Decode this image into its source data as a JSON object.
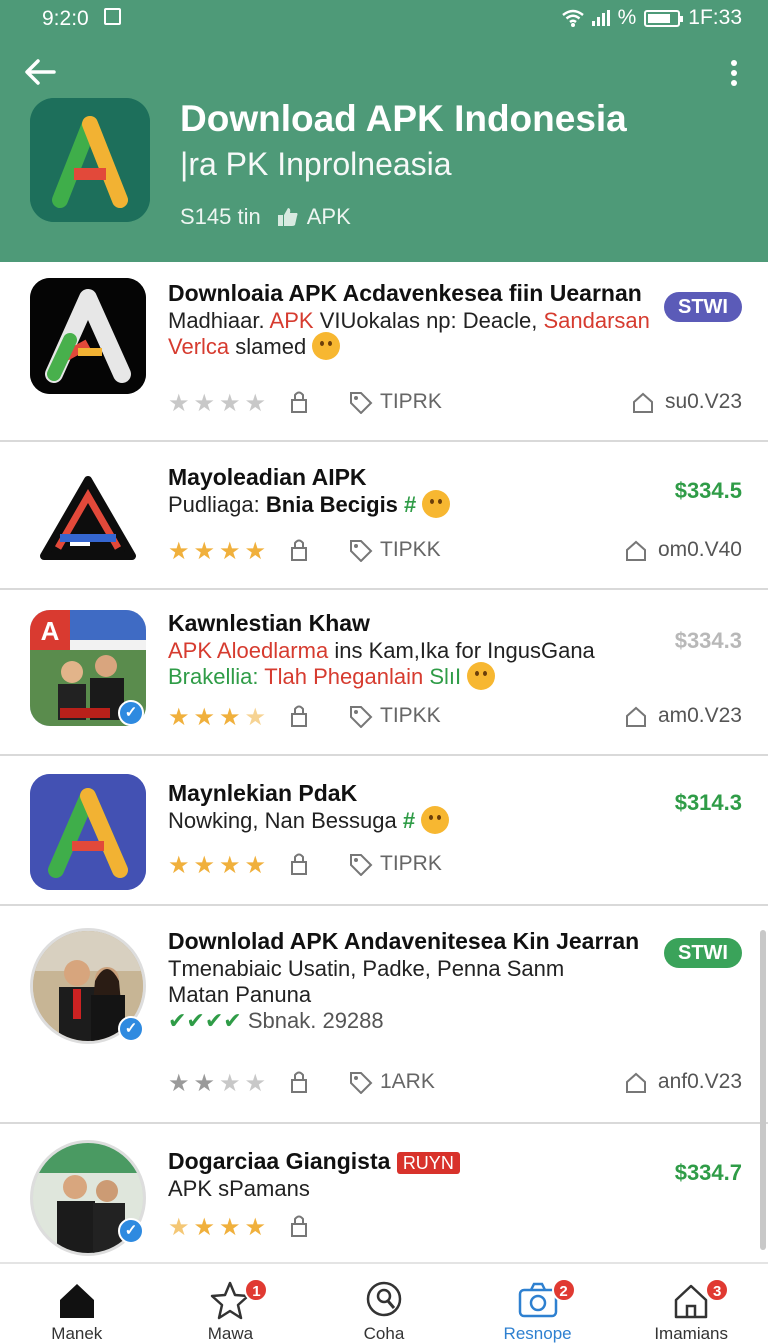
{
  "status_bar": {
    "time_left": "9:2:0",
    "battery_percent_label": "%",
    "time_right": "1F:33"
  },
  "header": {
    "title": "Download APK Indonesia",
    "subtitle": "|ra PK Inprolneasia",
    "size": "S145 tin",
    "type": "APK",
    "icons": [
      "back-arrow-icon",
      "more-vert-icon",
      "thumbs-up-icon"
    ],
    "color": "#4e9a78"
  },
  "items": [
    {
      "title": "Downloaia APK Acdavenkesea fiin Uearnan",
      "desc1": "Madhiaar.",
      "desc1_red1": "APK",
      "desc1_mid": "VIUokalas np: Deacle,",
      "desc1_red2": "Sandarsan",
      "desc2_red": "Verlca",
      "desc2": "slamed",
      "badge": "STWI",
      "badge_color": "#5b5bb8",
      "rating": 0,
      "tag": "TIPRK",
      "version": "su0.V23"
    },
    {
      "title": "Mayoleadian AIPK",
      "desc1": "Pudliaga:",
      "desc1_bold": "Bnia Becigis",
      "desc1_green": "#",
      "price": "$334.5",
      "rating": 4,
      "tag": "TIPKK",
      "version": "om0.V40"
    },
    {
      "title": "Kawnlestian Khaw",
      "desc1_red": "APK Aloedlarma",
      "desc1": "ins Kam,Ika for IngusGana",
      "desc2_green": "Brakellia:",
      "desc2_red": "Tlah Pheganlain",
      "desc2_green2": "SlıI",
      "price": "$334.3",
      "rating": 3.5,
      "tag": "TIPKK",
      "version": "am0.V23"
    },
    {
      "title": "Maynlekian PdaK",
      "desc1": "Nowking, Nan Bessuga",
      "desc1_green": "#",
      "price": "$314.3",
      "rating": 4,
      "tag": "TIPRK"
    },
    {
      "title": "Downlolad APK Andavenitesea Kin Jearran",
      "desc1": "Tmenabiaic Usatin, Padke, Penna Sanm",
      "desc2": "Matan Panuna",
      "desc3_green": "✔✔✔✔",
      "desc3": "Sbnak. 29288",
      "badge": "STWI",
      "badge_color": "#3aa35a",
      "rating": 2,
      "tag": "1ARK",
      "version": "anf0.V23"
    },
    {
      "title": "Dogarciaa Giangista",
      "title_badge": "RUYN",
      "desc1": "APK sPamans",
      "price": "$334.7",
      "rating": 4
    }
  ],
  "nav": [
    {
      "label": "Manek",
      "icon": "home-icon",
      "badge": ""
    },
    {
      "label": "Mawa",
      "icon": "star-icon",
      "badge": "1"
    },
    {
      "label": "Coha",
      "icon": "search-icon",
      "badge": ""
    },
    {
      "label": "Resnope",
      "icon": "camera-icon",
      "badge": "2",
      "active": true
    },
    {
      "label": "Imamians",
      "icon": "house-icon",
      "badge": "3"
    }
  ]
}
